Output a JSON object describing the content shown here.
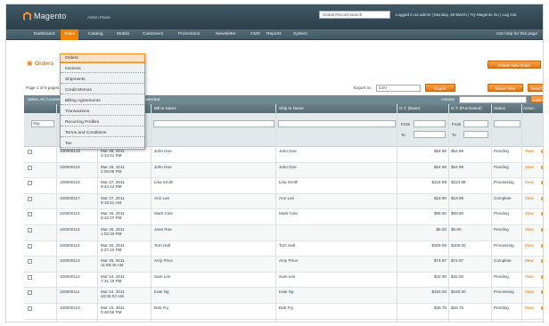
{
  "header": {
    "logo_text": "Magento",
    "logo_sub": "Admin Panel",
    "search_placeholder": "Global Record Search",
    "links": "Logged in as admin | Monday, 28 March | Try Magento Go | Log Out"
  },
  "nav": {
    "items": [
      "Dashboard",
      "Sales",
      "Catalog",
      "Mobile",
      "Customers",
      "Promotions",
      "Newsletter",
      "CMS",
      "Reports",
      "System"
    ],
    "right": "Get help for this page"
  },
  "dropdown": {
    "items": [
      "Orders",
      "Invoices",
      "Shipments",
      "Credit Memos",
      "Billing Agreements",
      "Transactions",
      "Recurring Profiles",
      "Terms and Conditions",
      "Tax"
    ]
  },
  "page": {
    "title": "Orders",
    "create_button": "Create New Order"
  },
  "toolbar": {
    "page_text": "Page 1 of 6 pages | View 20 per page | Total 104 records found",
    "export_label": "Export to:",
    "export_value": "CSV",
    "export_button": "Export",
    "reset_button": "Reset Filter",
    "search_button": "Search"
  },
  "massbar": {
    "left": "Select All | Unselect All | Select Visible | Unselect Visible | 0 items selected",
    "actions_label": "Actions",
    "submit": "Submit"
  },
  "grid": {
    "headers": [
      "Order #",
      "Purchased On",
      "Bill to Name",
      "Ship to Name",
      "G.T. (Base)",
      "G.T. (Purchased)",
      "Status",
      "Action"
    ],
    "any": "Any",
    "from": "From",
    "to": "To",
    "rows": [
      {
        "order": "100000120",
        "date": "Mar 28, 2011",
        "time": "2:13:41 PM",
        "bill": "John Doe",
        "ship": "John Doe",
        "gt_base": "$54.99",
        "gt_purchased": "$54.99",
        "status": "Pending",
        "action": "View"
      },
      {
        "order": "100000119",
        "date": "Mar 28, 2011",
        "time": "2:09:08 PM",
        "bill": "John Doe",
        "ship": "John Doe",
        "gt_base": "$54.99",
        "gt_purchased": "$54.99",
        "status": "Pending",
        "action": "View"
      },
      {
        "order": "100000118",
        "date": "Mar 27, 2011",
        "time": "8:44:22 PM",
        "bill": "Lisa Smith",
        "ship": "Lisa Smith",
        "gt_base": "$224.98",
        "gt_purchased": "$224.98",
        "status": "Processing",
        "action": "View"
      },
      {
        "order": "100000117",
        "date": "Mar 27, 2011",
        "time": "9:15:51 AM",
        "bill": "Ann Lee",
        "ship": "Ann Lee",
        "gt_base": "$19.99",
        "gt_purchased": "$19.99",
        "status": "Complete",
        "action": "View"
      },
      {
        "order": "100000116",
        "date": "Mar 26, 2011",
        "time": "6:42:07 PM",
        "bill": "Mark Cole",
        "ship": "Mark Cole",
        "gt_base": "$89.50",
        "gt_purchased": "$89.50",
        "status": "Pending",
        "action": "View"
      },
      {
        "order": "100000115",
        "date": "Mar 26, 2011",
        "time": "1:02:33 PM",
        "bill": "Jane Roe",
        "ship": "",
        "gt_base": "$5.00",
        "gt_purchased": "$5.00",
        "status": "Pending",
        "action": "View"
      },
      {
        "order": "100000114",
        "date": "Mar 25, 2011",
        "time": "4:27:10 PM",
        "bill": "Tom Hall",
        "ship": "Tom Hall",
        "gt_base": "$309.00",
        "gt_purchased": "$309.00",
        "status": "Processing",
        "action": "View"
      },
      {
        "order": "100000113",
        "date": "Mar 25, 2011",
        "time": "11:58:45 AM",
        "bill": "Amy Price",
        "ship": "Amy Price",
        "gt_base": "$74.97",
        "gt_purchased": "$74.97",
        "status": "Complete",
        "action": "View"
      },
      {
        "order": "100000112",
        "date": "Mar 24, 2011",
        "time": "7:31:19 PM",
        "bill": "Sam Lee",
        "ship": "Sam Lee",
        "gt_base": "$42.00",
        "gt_purchased": "$42.00",
        "status": "Pending",
        "action": "View"
      },
      {
        "order": "100000111",
        "date": "Mar 24, 2011",
        "time": "10:05:02 AM",
        "bill": "Kate Ng",
        "ship": "Kate Ng",
        "gt_base": "$150.00",
        "gt_purchased": "$150.00",
        "status": "Processing",
        "action": "View"
      },
      {
        "order": "100000110",
        "date": "Mar 23, 2011",
        "time": "3:48:56 PM",
        "bill": "Bob Fry",
        "ship": "Bob Fry",
        "gt_base": "$28.75",
        "gt_purchased": "$28.75",
        "status": "Pending",
        "action": "View"
      }
    ]
  }
}
